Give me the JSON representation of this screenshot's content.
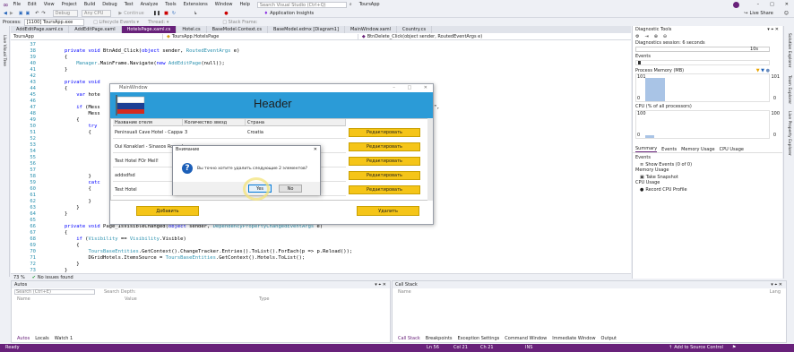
{
  "menubar": {
    "items": [
      "File",
      "Edit",
      "View",
      "Project",
      "Build",
      "Debug",
      "Test",
      "Analyze",
      "Tools",
      "Extensions",
      "Window",
      "Help"
    ],
    "search_placeholder": "Search Visual Studio (Ctrl+Q)",
    "solution_name": "ToursApp",
    "live_share": "Live Share"
  },
  "toolbar": {
    "config": "Debug",
    "platform": "Any CPU",
    "continue": "Continue",
    "app_insights": "Application Insights"
  },
  "process": {
    "label": "Process:",
    "value": "[1100] ToursApp.exe"
  },
  "tabs": [
    {
      "label": "AddEditPage.xaml.cs",
      "active": false
    },
    {
      "label": "AddEditPage.xaml",
      "active": false
    },
    {
      "label": "HotelsPage.xaml.cs",
      "active": true
    },
    {
      "label": "Hotel.cs",
      "active": false
    },
    {
      "label": "BaseModel.Context.cs",
      "active": false
    },
    {
      "label": "BaseModel.edmx [Diagram1]",
      "active": false
    },
    {
      "label": "MainWindow.xaml",
      "active": false
    },
    {
      "label": "Country.cs",
      "active": false
    }
  ],
  "navbar": {
    "project": "ToursApp",
    "class": "ToursApp.HotelsPage",
    "member": "BtnDelete_Click(object sender, RoutedEventArgs e)"
  },
  "code": [
    {
      "n": "37",
      "t": ""
    },
    {
      "n": "38",
      "t": "private void BtnAdd_Click(object sender, RoutedEventArgs e)"
    },
    {
      "n": "39",
      "t": "{"
    },
    {
      "n": "40",
      "t": "    Manager.MainFrame.Navigate(new AddEditPage(null));"
    },
    {
      "n": "41",
      "t": "}"
    },
    {
      "n": "42",
      "t": ""
    },
    {
      "n": "43",
      "t": "private void"
    },
    {
      "n": "44",
      "t": "{"
    },
    {
      "n": "45",
      "t": "    var hote"
    },
    {
      "n": "46",
      "t": ""
    },
    {
      "n": "47",
      "t": "    if (Mess"
    },
    {
      "n": "48",
      "t": "        Mess"
    },
    {
      "n": "49",
      "t": "    {"
    },
    {
      "n": "50",
      "t": "        try"
    },
    {
      "n": "51",
      "t": "        {"
    },
    {
      "n": "52",
      "t": ""
    },
    {
      "n": "53",
      "t": ""
    },
    {
      "n": "54",
      "t": ""
    },
    {
      "n": "55",
      "t": ""
    },
    {
      "n": "56",
      "t": ""
    },
    {
      "n": "57",
      "t": ""
    },
    {
      "n": "58",
      "t": "        }"
    },
    {
      "n": "59",
      "t": "        catc"
    },
    {
      "n": "60",
      "t": "        {"
    },
    {
      "n": "61",
      "t": ""
    },
    {
      "n": "62",
      "t": "        }"
    },
    {
      "n": "63",
      "t": "    }"
    },
    {
      "n": "64",
      "t": "}"
    },
    {
      "n": "65",
      "t": ""
    },
    {
      "n": "66",
      "t": "private void Page_IsVisibleChanged(object sender, DependencyPropertyChangedEventArgs e)"
    },
    {
      "n": "67",
      "t": "{"
    },
    {
      "n": "68",
      "t": "    if (Visibility == Visibility.Visible)"
    },
    {
      "n": "69",
      "t": "    {"
    },
    {
      "n": "70",
      "t": "        ToursBaseEntities.GetContext().ChangeTracker.Entries().ToList().ForEach(p => p.Reload());"
    },
    {
      "n": "71",
      "t": "        DGridHotels.ItemsSource = ToursBaseEntities.GetContext().Hotels.ToList();"
    },
    {
      "n": "72",
      "t": "    }"
    },
    {
      "n": "73",
      "t": "}"
    }
  ],
  "code_tail_48": "\",",
  "editor_status": {
    "zoom": "73 %",
    "issues": "No issues found"
  },
  "autos": {
    "title": "Autos",
    "search_placeholder": "Search (Ctrl+E)",
    "search_depth": "Search Depth:",
    "columns": [
      "Name",
      "Value",
      "Type"
    ],
    "bottom_tabs": [
      "Autos",
      "Locals",
      "Watch 1"
    ]
  },
  "callstack": {
    "title": "Call Stack",
    "columns": [
      "Name",
      "Lang"
    ],
    "bottom_tabs": [
      "Call Stack",
      "Breakpoints",
      "Exception Settings",
      "Command Window",
      "Immediate Window",
      "Output"
    ]
  },
  "diagnostics": {
    "title": "Diagnostic Tools",
    "session": "Diagnostics session: 6 seconds",
    "session_scale": "10s",
    "events": "Events",
    "process_memory": "Process Memory (MB)",
    "mem_top": "101",
    "mem_bottom": "0",
    "cpu": "CPU (% of all processors)",
    "cpu_top": "100",
    "cpu_bottom": "0",
    "tabs": [
      "Summary",
      "Events",
      "Memory Usage",
      "CPU Usage"
    ],
    "events_section": "Events",
    "show_events": "Show Events (0 of 0)",
    "memory_section": "Memory Usage",
    "take_snapshot": "Take Snapshot",
    "cpu_section": "CPU Usage",
    "record_cpu": "Record CPU Profile"
  },
  "right_strip": [
    "Solution Explorer",
    "Team Explorer",
    "Live Property Explorer"
  ],
  "left_strip": [
    "Live Visual Tree"
  ],
  "wpf": {
    "title": "MainWindow",
    "header": "Header",
    "columns": [
      "Название отеля",
      "Количество звезд",
      "Страна"
    ],
    "rows": [
      {
        "name": "Peninsuali Cave Hotel - Cappac",
        "stars": "3",
        "country": "Croatia"
      },
      {
        "name": "Oui Konaklari - Sinasos Room Ho",
        "stars": "",
        "country": ""
      },
      {
        "name": "Test Hotel FOr Mell!",
        "stars": "",
        "country": ""
      },
      {
        "name": "addsdfsd",
        "stars": "",
        "country": ""
      },
      {
        "name": "Test Hotel",
        "stars": "",
        "country": ""
      }
    ],
    "edit_label": "Редактировать",
    "add_label": "Добавить",
    "delete_label": "Удалить"
  },
  "msgbox": {
    "title": "Внимание",
    "text": "Вы точно хотите удалить следующие 2 элементов?",
    "yes": "Yes",
    "no": "No"
  },
  "statusbar": {
    "left": "Ready",
    "ln": "Ln 56",
    "col": "Col 21",
    "ch": "Ch 21",
    "ins": "INS",
    "source_control": "Add to Source Control"
  }
}
